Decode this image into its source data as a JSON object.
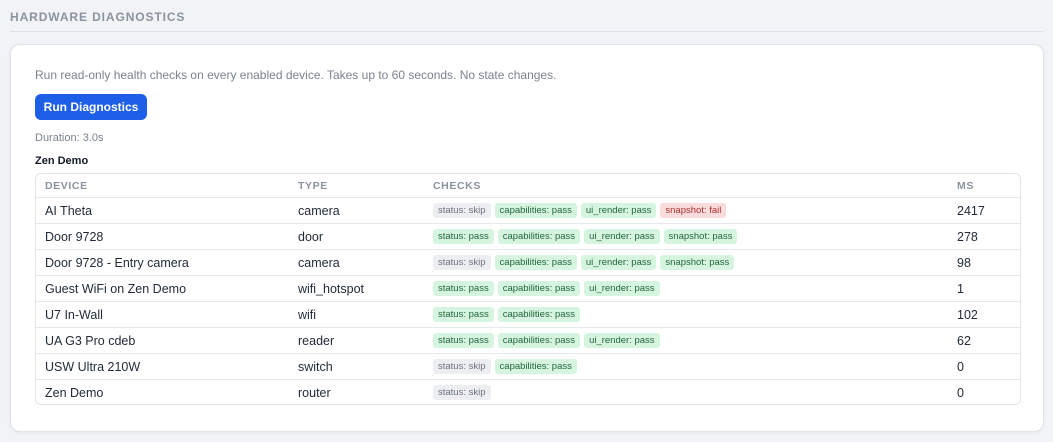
{
  "section_title": "HARDWARE DIAGNOSTICS",
  "description": "Run read-only health checks on every enabled device. Takes up to 60 seconds. No state changes.",
  "run_button_label": "Run Diagnostics",
  "duration": "Duration: 3.0s",
  "group": {
    "title": "Zen Demo",
    "columns": {
      "device": "DEVICE",
      "type": "TYPE",
      "checks": "CHECKS",
      "ms": "MS"
    },
    "rows": [
      {
        "device": "AI Theta",
        "type": "camera",
        "ms": "2417",
        "checks": [
          {
            "label": "status: skip",
            "result": "skip"
          },
          {
            "label": "capabilities: pass",
            "result": "pass"
          },
          {
            "label": "ui_render: pass",
            "result": "pass"
          },
          {
            "label": "snapshot: fail",
            "result": "fail"
          }
        ]
      },
      {
        "device": "Door 9728",
        "type": "door",
        "ms": "278",
        "checks": [
          {
            "label": "status: pass",
            "result": "pass"
          },
          {
            "label": "capabilities: pass",
            "result": "pass"
          },
          {
            "label": "ui_render: pass",
            "result": "pass"
          },
          {
            "label": "snapshot: pass",
            "result": "pass"
          }
        ]
      },
      {
        "device": "Door 9728 - Entry camera",
        "type": "camera",
        "ms": "98",
        "checks": [
          {
            "label": "status: skip",
            "result": "skip"
          },
          {
            "label": "capabilities: pass",
            "result": "pass"
          },
          {
            "label": "ui_render: pass",
            "result": "pass"
          },
          {
            "label": "snapshot: pass",
            "result": "pass"
          }
        ]
      },
      {
        "device": "Guest WiFi on Zen Demo",
        "type": "wifi_hotspot",
        "ms": "1",
        "checks": [
          {
            "label": "status: pass",
            "result": "pass"
          },
          {
            "label": "capabilities: pass",
            "result": "pass"
          },
          {
            "label": "ui_render: pass",
            "result": "pass"
          }
        ]
      },
      {
        "device": "U7 In-Wall",
        "type": "wifi",
        "ms": "102",
        "checks": [
          {
            "label": "status: pass",
            "result": "pass"
          },
          {
            "label": "capabilities: pass",
            "result": "pass"
          }
        ]
      },
      {
        "device": "UA G3 Pro cdeb",
        "type": "reader",
        "ms": "62",
        "checks": [
          {
            "label": "status: pass",
            "result": "pass"
          },
          {
            "label": "capabilities: pass",
            "result": "pass"
          },
          {
            "label": "ui_render: pass",
            "result": "pass"
          }
        ]
      },
      {
        "device": "USW Ultra 210W",
        "type": "switch",
        "ms": "0",
        "checks": [
          {
            "label": "status: skip",
            "result": "skip"
          },
          {
            "label": "capabilities: pass",
            "result": "pass"
          }
        ]
      },
      {
        "device": "Zen Demo",
        "type": "router",
        "ms": "0",
        "checks": [
          {
            "label": "status: skip",
            "result": "skip"
          }
        ]
      }
    ]
  },
  "colors": {
    "accent": "#1d5fe6",
    "pass_bg": "#d6f5e0",
    "skip_bg": "#eceef1",
    "fail_bg": "#fbdcdc"
  }
}
